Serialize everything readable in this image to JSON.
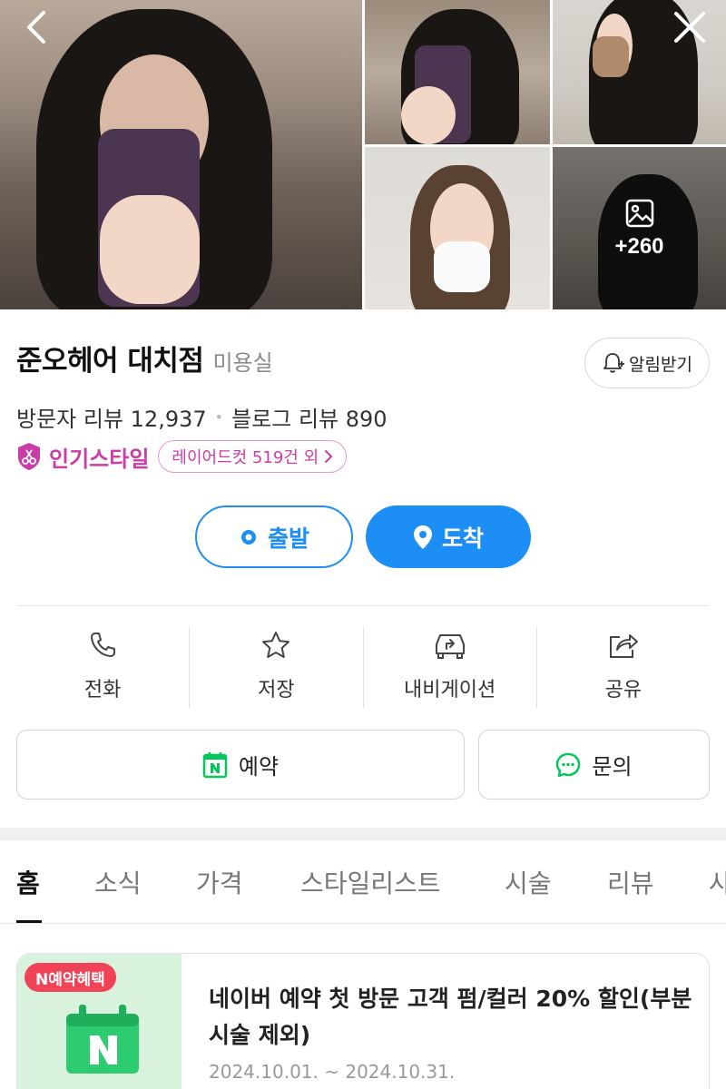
{
  "gallery": {
    "more_count": "+260",
    "icons": {
      "back": "chevron-left-icon",
      "close": "close-icon",
      "photo": "image-icon"
    }
  },
  "shop": {
    "name": "준오헤어 대치점",
    "category": "미용실",
    "alarm_label": "알림받기",
    "visitor_reviews": "방문자 리뷰 12,937",
    "blog_reviews": "블로그 리뷰 890",
    "popular_label": "인기스타일",
    "popular_style": "레이어드컷 519건 외"
  },
  "route": {
    "start_label": "출발",
    "end_label": "도착"
  },
  "actions": [
    {
      "label": "전화",
      "icon": "phone-icon"
    },
    {
      "label": "저장",
      "icon": "star-icon"
    },
    {
      "label": "내비게이션",
      "icon": "navigation-car-icon"
    },
    {
      "label": "공유",
      "icon": "share-icon"
    }
  ],
  "buttons": {
    "book_label": "예약",
    "ask_label": "문의"
  },
  "tabs": [
    "홈",
    "소식",
    "가격",
    "스타일리스트",
    "시술",
    "리뷰",
    "사"
  ],
  "promo": {
    "badge": "N예약혜택",
    "title": "네이버 예약 첫 방문 고객 펌/컬러 20% 할인(부분 시술 제외)",
    "date": "2024.10.01. ~ 2024.10.31."
  },
  "colors": {
    "accent_blue": "#1e8ef7",
    "popular_pink": "#cc3ca6",
    "naver_green": "#03c75a",
    "promo_red": "#f04358"
  }
}
